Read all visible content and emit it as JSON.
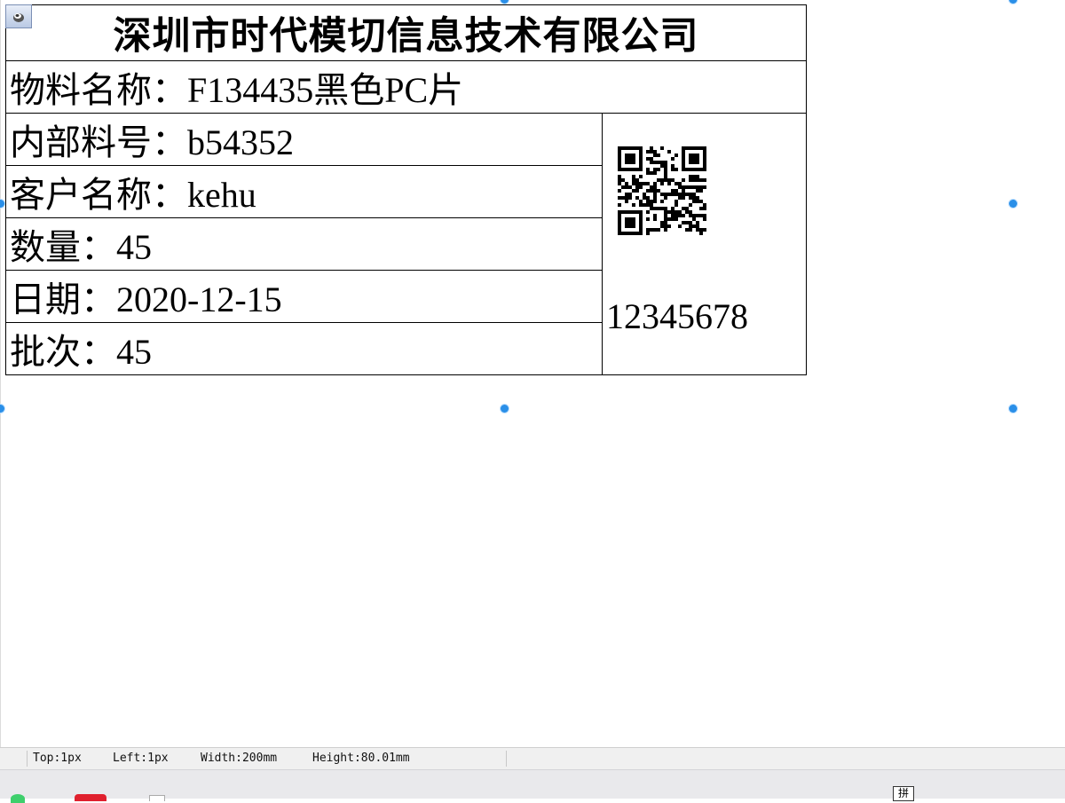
{
  "label": {
    "company": "深圳市时代模切信息技术有限公司",
    "material_name": "物料名称：F134435黑色PC片",
    "internal_part_no": "内部料号：b54352",
    "customer_name": "客户名称：kehu",
    "quantity": "数量：45",
    "date": "日期：2020-12-15",
    "batch": "批次：45",
    "serial": "12345678"
  },
  "status_bar": {
    "top": "Top:1px",
    "left": "Left:1px",
    "width": "Width:200mm",
    "height": "Height:80.01mm"
  },
  "taskbar": {
    "ime_indicator": "拼"
  },
  "colors": {
    "selection_handle": "#2a8fe8",
    "status_bar_bg": "#f0f0f0",
    "table_border": "#000000"
  },
  "icons": {
    "selection_anchor": "move-handle-icon",
    "qr": "qr-code-icon"
  }
}
